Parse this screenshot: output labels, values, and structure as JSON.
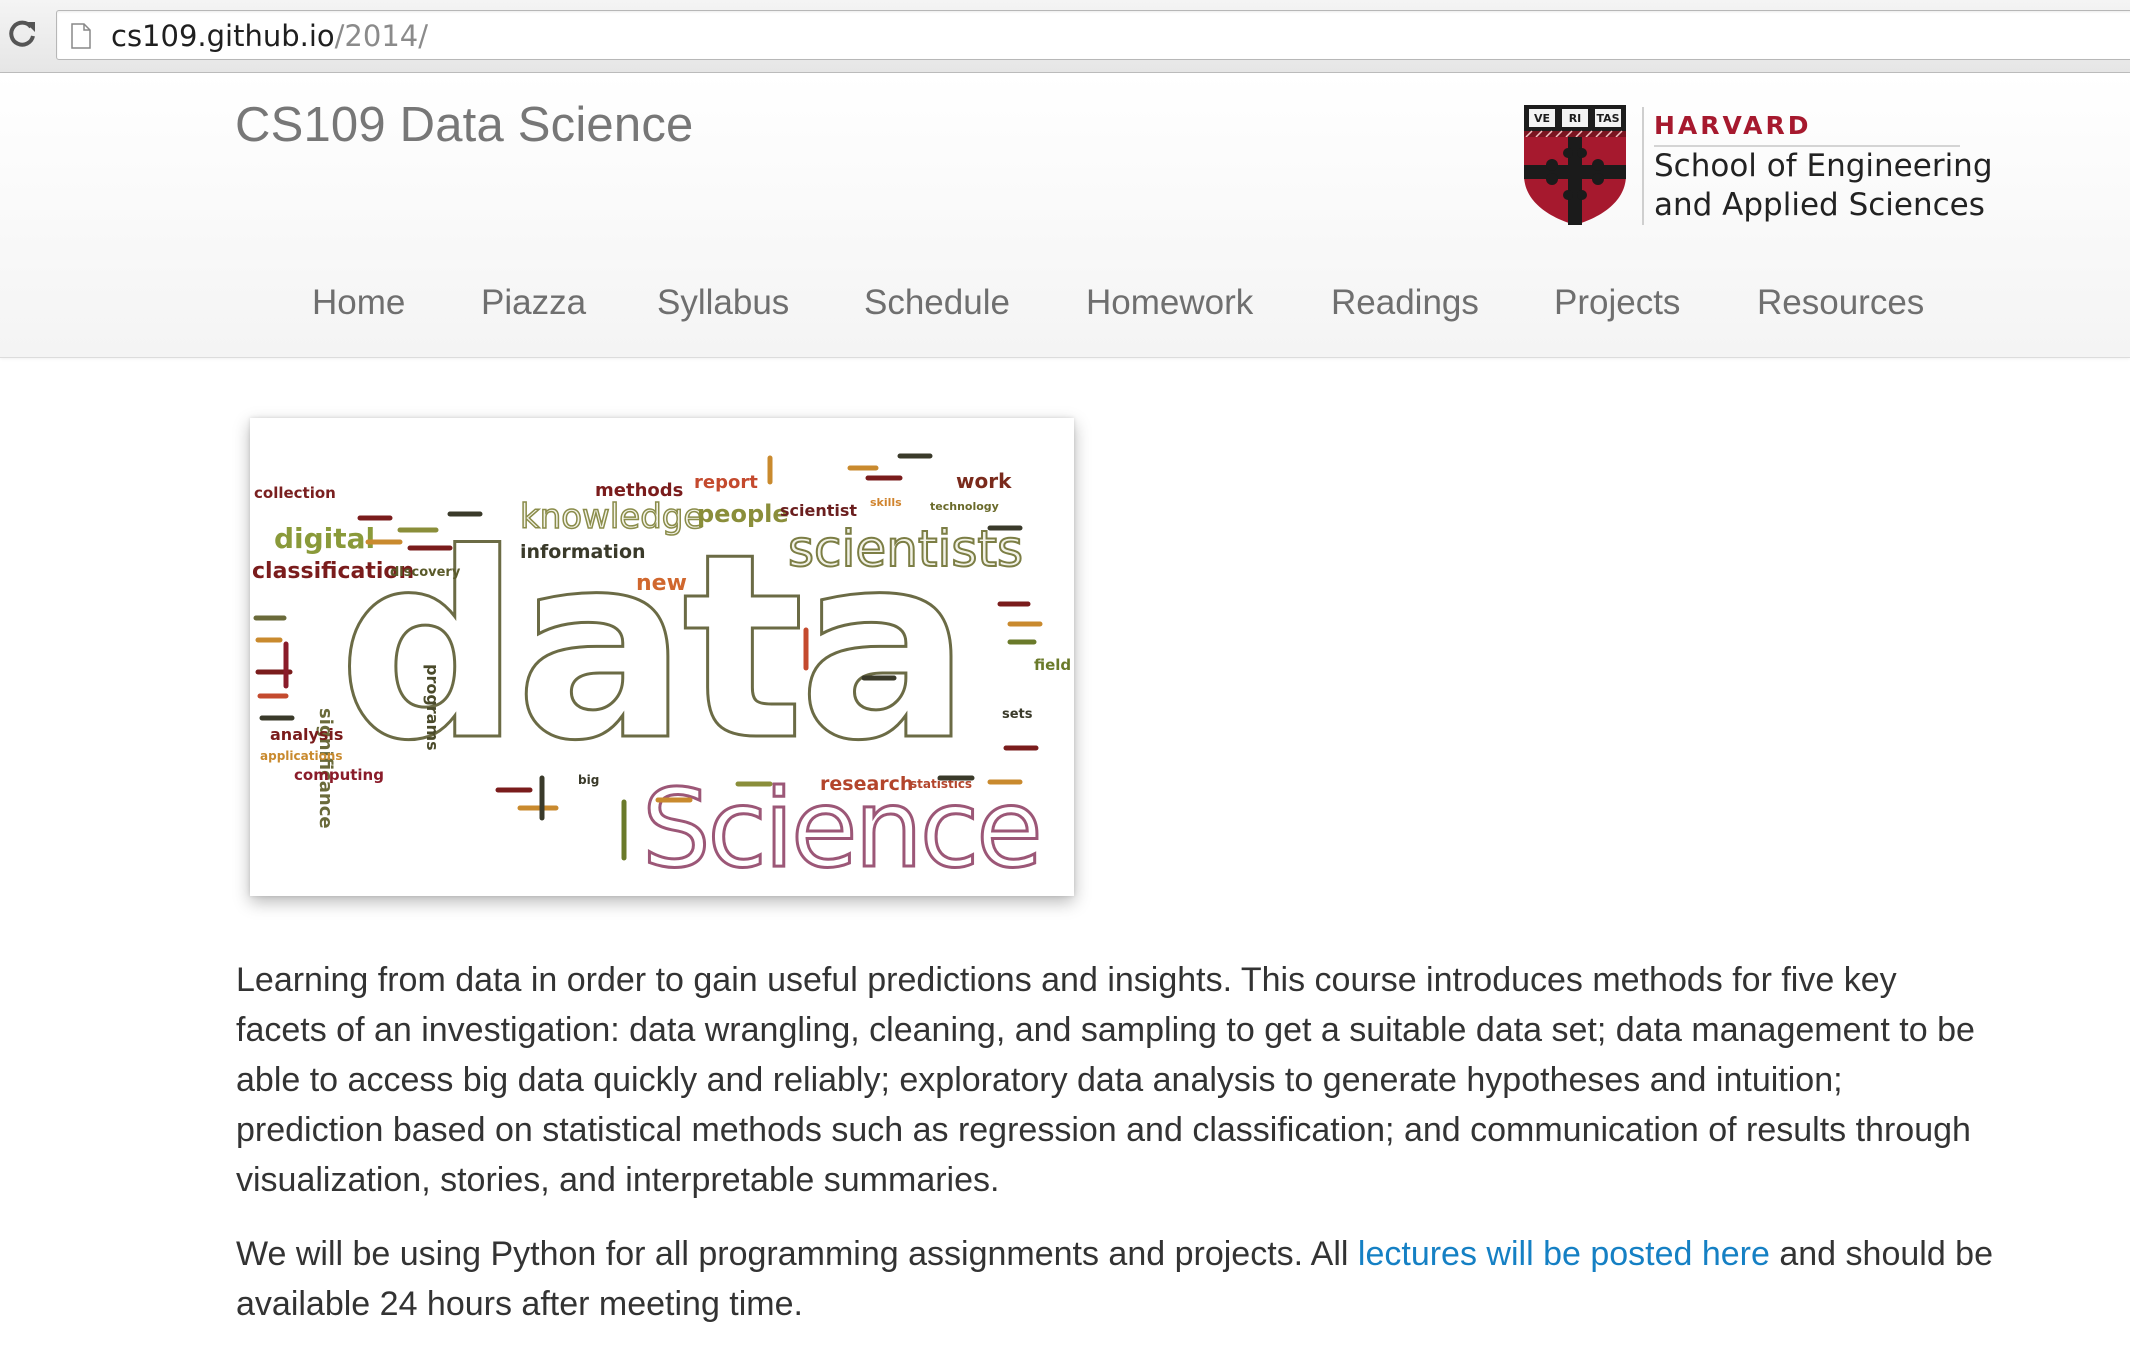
{
  "browser": {
    "url_host": "cs109.github.io",
    "url_path": "/2014/"
  },
  "site": {
    "title": "CS109 Data Science",
    "logo": {
      "institution": "HARVARD",
      "shield_motto": [
        "VE",
        "RI",
        "TAS"
      ],
      "school_line_1": "School of Engineering",
      "school_line_2": "and Applied Sciences"
    },
    "nav": [
      "Home",
      "Piazza",
      "Syllabus",
      "Schedule",
      "Homework",
      "Readings",
      "Projects",
      "Resources"
    ]
  },
  "hero_image": {
    "words_large": [
      "data",
      "Science",
      "scientists",
      "knowledge"
    ],
    "words_small": [
      "collection",
      "methods",
      "report",
      "work",
      "people",
      "scientist",
      "digital",
      "information",
      "classification",
      "discovery",
      "new",
      "significance",
      "programs",
      "analysis",
      "applications",
      "computing",
      "research",
      "statistics",
      "field",
      "sets",
      "big",
      "technology",
      "skills"
    ]
  },
  "content": {
    "paragraph_1": "Learning from data in order to gain useful predictions and insights. This course introduces methods for five key facets of an investigation: data wrangling, cleaning, and sampling to get a suitable data set; data management to be able to access big data quickly and reliably; exploratory data analysis to generate hypotheses and intuition; prediction based on statistical methods such as regression and classification; and communication of results through visualization, stories, and interpretable summaries.",
    "paragraph_2_before": "We will be using Python for all programming assignments and projects. All ",
    "paragraph_2_link": "lectures will be posted here",
    "paragraph_2_after": " and should be available 24 hours after meeting time."
  },
  "colors": {
    "link": "#1580c4",
    "harvard_crimson": "#a6192e",
    "nav_text": "#6f6f6f"
  }
}
